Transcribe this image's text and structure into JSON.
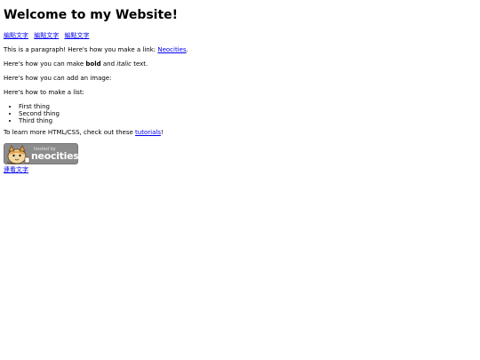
{
  "page": {
    "heading": "Welcome to my Website!",
    "nav_links": [
      "編點文字",
      "編點文字",
      "編點文字"
    ],
    "para_link": {
      "before": "This is a paragraph! Here's how you make a link: ",
      "link_text": "Neocities",
      "after": "."
    },
    "para_format": {
      "before": "Here's how you can make ",
      "bold": "bold",
      "middle": " and ",
      "italic": "italic",
      "after": " text."
    },
    "para_image": "Here's how you can add an image:",
    "para_list": "Here's how to make a list:",
    "list_items": [
      "First thing",
      "Second thing",
      "Third thing"
    ],
    "para_learn": {
      "before": "To learn more HTML/CSS, check out these ",
      "link_text": "tutorials",
      "after": "!"
    },
    "badge": {
      "hosted_text": "hosted by",
      "brand_text": "neocities",
      "icon": "neocities-cat-icon"
    },
    "footer_link": "連看文字"
  }
}
